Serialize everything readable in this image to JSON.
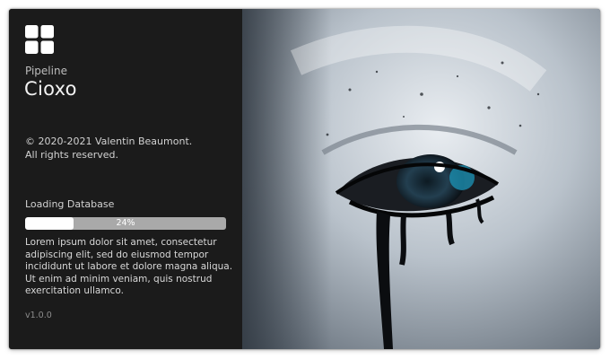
{
  "app": {
    "suite_name": "Pipeline",
    "name": "Cioxo",
    "logo_icon": "four-squares-logo-icon"
  },
  "copyright": {
    "line1": "© 2020-2021 Valentin Beaumont.",
    "line2": "All rights reserved."
  },
  "loading": {
    "label": "Loading Database",
    "progress_percent": 24,
    "progress_text": "24%",
    "status_text": "Lorem ipsum dolor sit amet, consectetur adipiscing elit, sed do eiusmod tempor incididunt ut labore et dolore magna aliqua. Ut enim ad minim veniam, quis nostrud exercitation ullamco."
  },
  "version": "v1.0.0",
  "colors": {
    "panel_background": "#1b1b1b",
    "progress_track": "#a9a9a9",
    "progress_fill": "#ffffff"
  },
  "splash_image": {
    "subject": "close-up of a pale face with an eye crying black tears"
  }
}
